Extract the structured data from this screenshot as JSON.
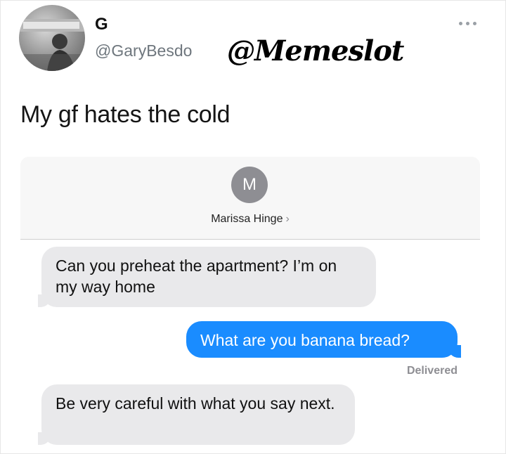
{
  "tweet": {
    "display_name": "G",
    "handle": "@GaryBesdo",
    "watermark": "@Memeslot",
    "text": "My gf hates the cold",
    "avatar_icon": "user-avatar-photo",
    "more_icon": "more-horizontal-icon"
  },
  "conversation": {
    "contact_initial": "M",
    "contact_name": "Marissa Hinge",
    "contact_chevron": "›",
    "messages": [
      {
        "direction": "incoming",
        "text": "Can you preheat the apartment? I’m on my way home"
      },
      {
        "direction": "outgoing",
        "text": "What are you banana bread?"
      },
      {
        "direction": "incoming",
        "text": "Be very careful with what you say next."
      }
    ],
    "delivered_label": "Delivered"
  },
  "colors": {
    "outgoing_bubble": "#1a8cff",
    "incoming_bubble": "#e9e9eb",
    "muted_text": "#8e8e93"
  }
}
